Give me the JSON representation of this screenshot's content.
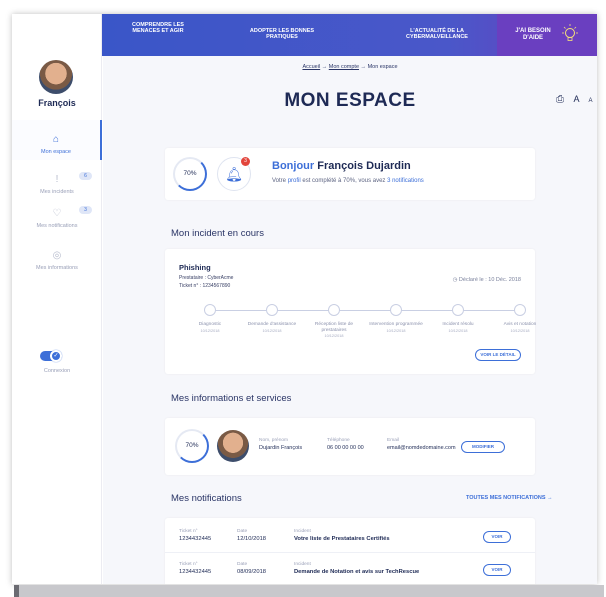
{
  "user": {
    "name": "François"
  },
  "sidebar": {
    "items": [
      {
        "label": "Mon espace",
        "icon": "home-icon"
      },
      {
        "label": "Mes incidents",
        "icon": "incident-icon",
        "badge": "6"
      },
      {
        "label": "Mes notifications",
        "icon": "notification-icon",
        "badge": "3"
      },
      {
        "label": "Mes informations",
        "icon": "info-icon"
      }
    ],
    "connexion_label": "Connexion"
  },
  "topnav": {
    "items": [
      {
        "label": "COMPRENDRE LES MENACES ET AGIR"
      },
      {
        "label": "ADOPTER LES BONNES PRATIQUES"
      },
      {
        "label": "L'ACTUALITÉ DE LA CYBERMALVEILLANCE"
      }
    ],
    "help_label": "J'AI BESOIN D'AIDE"
  },
  "breadcrumb": {
    "home": "Accueil",
    "sep": "→",
    "account": "Mon compte",
    "current": "Mon espace"
  },
  "page_title": "MON ESPACE",
  "tools": {
    "print": "print-icon",
    "font_large": "A",
    "font_small": "A"
  },
  "welcome": {
    "progress": "70%",
    "bell_count": "3",
    "hello": "Bonjour",
    "full_name": "François Dujardin",
    "sub_prefix": "Votre ",
    "sub_profile": "profil",
    "sub_middle": " est complété à 70%, vous avez ",
    "sub_notifs": "3 notifications"
  },
  "incident_section": {
    "title": "Mon incident en cours",
    "incident_title": "Phishing",
    "provider": "Prestataire : CyberAcme",
    "ticket": "Ticket n° : 1234567890",
    "declared": "Déclaré le : 10 Déc. 2018",
    "steps": [
      {
        "label": "Diagnostic",
        "date": "10/12/2018"
      },
      {
        "label": "Demande d'assistance",
        "date": "10/12/2018"
      },
      {
        "label": "Réception liste de prestataires",
        "date": "10/12/2018"
      },
      {
        "label": "Intervention programmée",
        "date": "10/12/2018"
      },
      {
        "label": "Incident résolu",
        "date": "10/12/2018"
      },
      {
        "label": "Avis et notation",
        "date": "10/12/2018"
      }
    ],
    "detail_button": "VOIR LE DÉTAIL"
  },
  "infos_section": {
    "title": "Mes informations et services",
    "progress": "70%",
    "name_key": "Nom, prénom",
    "name_val": "Dujardin François",
    "phone_key": "Téléphone",
    "phone_val": "06 00 00 00 00",
    "email_key": "Email",
    "email_val": "email@nomdedomaine.com",
    "modify_button": "MODIFIER"
  },
  "notifs_section": {
    "title": "Mes notifications",
    "all_link": "TOUTES MES NOTIFICATIONS →",
    "ticket_key": "Ticket n°",
    "date_key": "Date",
    "incident_key": "Incident",
    "rows": [
      {
        "ticket": "1234432445",
        "date": "12/10/2018",
        "incident": "Votre liste de Prestataires Certifiés",
        "button": "VOIR"
      },
      {
        "ticket": "1234432445",
        "date": "08/09/2018",
        "incident": "Demande de Notation et avis sur TechRescue",
        "button": "VOIR"
      }
    ]
  },
  "colors": {
    "primary": "#3d6fd8",
    "navy": "#1e2a55",
    "help_bg": "#6a3fc0",
    "alert": "#e2453c"
  }
}
